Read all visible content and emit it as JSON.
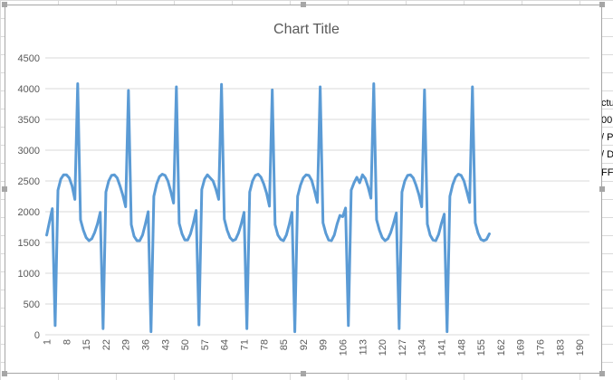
{
  "side_text": [
    "ctu",
    "00",
    "/ P",
    "/ D",
    "FF"
  ],
  "chart_data": {
    "type": "line",
    "title": "Chart Title",
    "xlabel": "",
    "ylabel": "",
    "ylim": [
      0,
      4500
    ],
    "yticks": [
      0,
      500,
      1000,
      1500,
      2000,
      2500,
      3000,
      3500,
      4000,
      4500
    ],
    "x_tick_labels": [
      "1",
      "8",
      "15",
      "22",
      "29",
      "36",
      "43",
      "50",
      "57",
      "64",
      "71",
      "78",
      "85",
      "92",
      "99",
      "106",
      "113",
      "120",
      "127",
      "134",
      "141",
      "148",
      "155",
      "162",
      "169",
      "176",
      "183",
      "190"
    ],
    "x_count": 193,
    "grid": true,
    "legend": "none",
    "color": "#5b9bd5",
    "series": [
      {
        "values": [
          1620,
          1840,
          2050,
          150,
          2350,
          2530,
          2600,
          2600,
          2550,
          2420,
          2200,
          4080,
          1870,
          1700,
          1580,
          1530,
          1560,
          1660,
          1800,
          1990,
          100,
          2320,
          2500,
          2590,
          2600,
          2550,
          2420,
          2270,
          2080,
          3970,
          1790,
          1600,
          1530,
          1530,
          1620,
          1800,
          2000,
          50,
          2250,
          2450,
          2570,
          2610,
          2590,
          2500,
          2330,
          2140,
          4030,
          1810,
          1640,
          1540,
          1540,
          1640,
          1810,
          2020,
          160,
          2360,
          2530,
          2600,
          2550,
          2500,
          2370,
          2200,
          4070,
          1880,
          1700,
          1580,
          1530,
          1550,
          1650,
          1800,
          1990,
          100,
          2320,
          2500,
          2590,
          2610,
          2560,
          2450,
          2300,
          2090,
          3980,
          1790,
          1620,
          1550,
          1530,
          1620,
          1790,
          1990,
          50,
          2250,
          2430,
          2550,
          2600,
          2590,
          2510,
          2340,
          2150,
          4030,
          1820,
          1650,
          1540,
          1530,
          1620,
          1800,
          1940,
          1920,
          2060,
          150,
          2350,
          2470,
          2560,
          2470,
          2600,
          2540,
          2400,
          2220,
          4080,
          1870,
          1700,
          1580,
          1530,
          1560,
          1660,
          1810,
          1980,
          100,
          2320,
          2500,
          2590,
          2600,
          2550,
          2430,
          2280,
          2080,
          3980,
          1800,
          1620,
          1540,
          1530,
          1630,
          1810,
          1960,
          50,
          2250,
          2440,
          2560,
          2610,
          2590,
          2500,
          2330,
          2150,
          4030,
          1820,
          1650,
          1550,
          1530,
          1550,
          1640
        ],
        "color": "#5b9bd5"
      }
    ]
  }
}
